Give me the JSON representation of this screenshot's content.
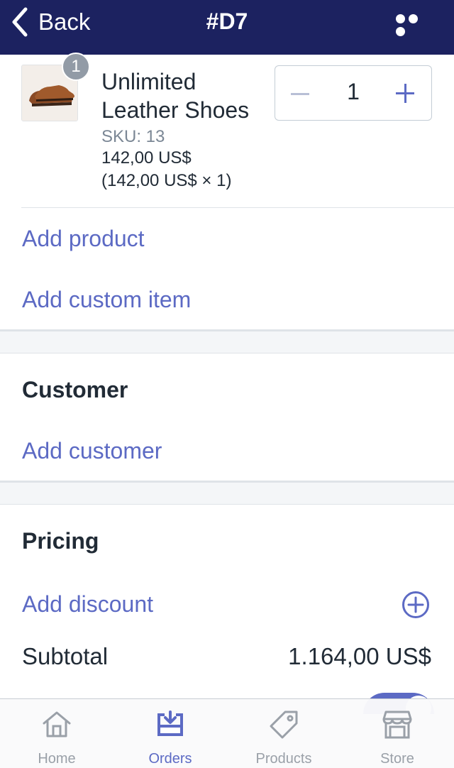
{
  "header": {
    "back_label": "Back",
    "title": "#D7",
    "more_icon": "more-icon"
  },
  "line_item": {
    "quantity_badge": "1",
    "name": "Unlimited Leather Shoes",
    "sku": "SKU: 13",
    "price": "142,00 US$",
    "price_calc": "(142,00 US$ × 1)",
    "quantity": "1"
  },
  "actions": {
    "add_product": "Add product",
    "add_custom_item": "Add custom item"
  },
  "customer": {
    "title": "Customer",
    "add_customer": "Add customer"
  },
  "pricing": {
    "title": "Pricing",
    "add_discount": "Add discount",
    "subtotal_label": "Subtotal",
    "subtotal_value": "1.164,00 US$"
  },
  "tabbar": {
    "tabs": [
      {
        "label": "Home",
        "icon": "home-icon",
        "active": false
      },
      {
        "label": "Orders",
        "icon": "orders-icon",
        "active": true
      },
      {
        "label": "Products",
        "icon": "tag-icon",
        "active": false
      },
      {
        "label": "Store",
        "icon": "store-icon",
        "active": false
      }
    ]
  },
  "colors": {
    "header_bg": "#1c2260",
    "accent": "#5c6ac4",
    "text": "#212b36",
    "muted": "#7b8795"
  }
}
